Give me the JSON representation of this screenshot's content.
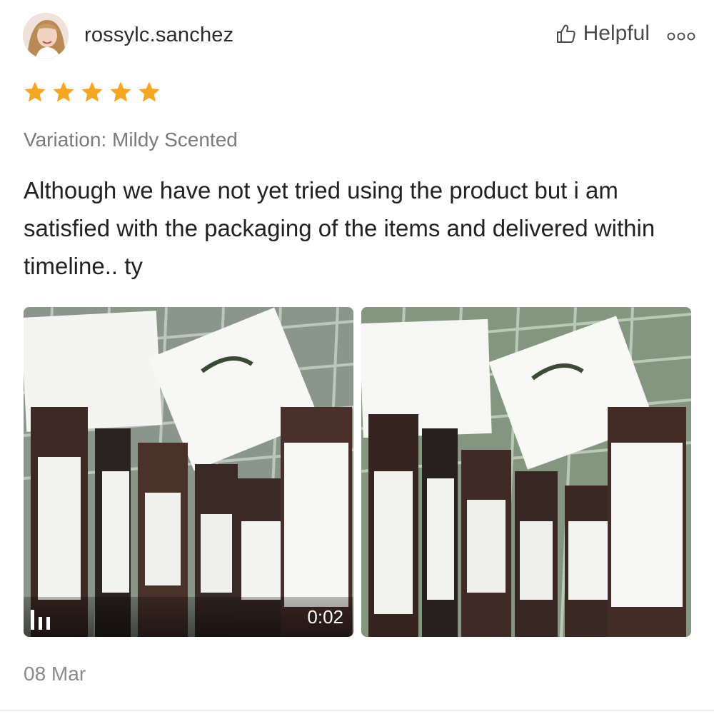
{
  "review": {
    "username": "rossylc.sanchez",
    "helpful_label": "Helpful",
    "rating": 5,
    "variation": "Variation: Mildy Scented",
    "text": "Although we have not yet tried using the product but i am satisfied with the packaging of the items and delivered within timeline.. ty",
    "date": "08 Mar"
  },
  "media": {
    "video_duration": "0:02"
  },
  "icons": {
    "star_color": "#f5a623",
    "helpful": "thumbs-up-icon",
    "more": "more-options-icon",
    "video": "video-icon"
  }
}
